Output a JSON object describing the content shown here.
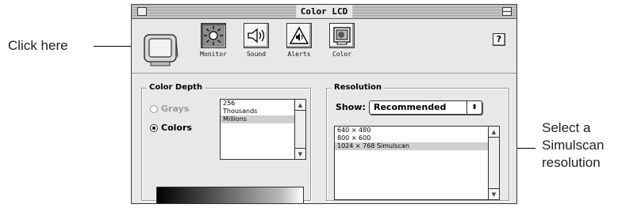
{
  "callouts": {
    "left": "Click here",
    "right_lines": [
      "Select a",
      "Simulscan",
      "resolution"
    ]
  },
  "window": {
    "title": "Color LCD",
    "help_label": "?"
  },
  "toolbar": {
    "items": [
      {
        "label": "Monitor",
        "icon": "brightness-sun-icon",
        "selected": true
      },
      {
        "label": "Sound",
        "icon": "speaker-icon",
        "selected": false
      },
      {
        "label": "Alerts",
        "icon": "alert-triangle-icon",
        "selected": false
      },
      {
        "label": "Color",
        "icon": "color-monitor-icon",
        "selected": false
      }
    ]
  },
  "color_depth": {
    "title": "Color Depth",
    "options": [
      {
        "label": "Grays",
        "selected": false,
        "enabled": false
      },
      {
        "label": "Colors",
        "selected": true,
        "enabled": true
      }
    ],
    "list": [
      "256",
      "Thousands",
      "Millions"
    ],
    "selected_index": 2
  },
  "resolution": {
    "title": "Resolution",
    "show_label": "Show:",
    "show_value": "Recommended",
    "list": [
      "640 × 480",
      "800 × 600",
      "1024 × 768   Simulscan"
    ],
    "selected_index": 2
  },
  "colors": {
    "window_bg": "#e8e8e8",
    "selection": "#cfcfcf",
    "selected_tool": "#8c8c8c"
  }
}
